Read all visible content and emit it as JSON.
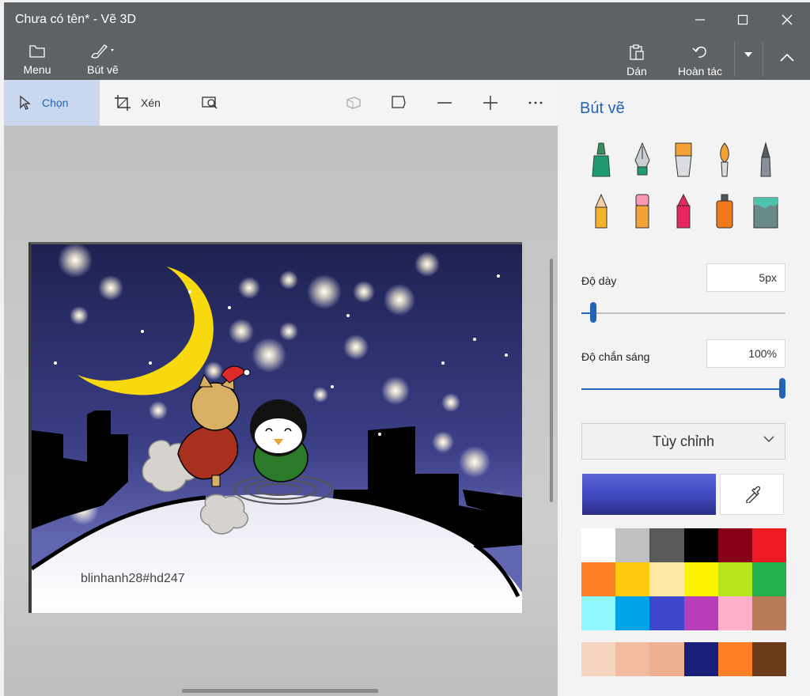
{
  "window": {
    "title": "Chưa có tên* - Vẽ 3D"
  },
  "ribbon": {
    "menu_label": "Menu",
    "brushes_label": "Bút vẽ",
    "paste_label": "Dán",
    "undo_label": "Hoàn tác"
  },
  "toolbar": {
    "select_label": "Chọn",
    "crop_label": "Xén"
  },
  "canvas": {
    "watermark_text": "blinhanh28#hd247"
  },
  "panel": {
    "title": "Bút vẽ",
    "brushes": [
      "marker",
      "calligraphy-pen",
      "oil-brush",
      "watercolor",
      "pixel-pen",
      "pencil",
      "eraser",
      "crayon",
      "spray-can",
      "fill-bucket"
    ],
    "thickness_label": "Độ dày",
    "thickness_value": "5px",
    "thickness_level": 0.05,
    "opacity_label": "Độ chắn sáng",
    "opacity_value": "100%",
    "opacity_level": 1.0,
    "finish_select": "Tùy chỉnh",
    "current_color": "#3e49c0",
    "palette": [
      "#ffffff",
      "#c0c0c0",
      "#595959",
      "#000000",
      "#880015",
      "#ed1c24",
      "#ff7f27",
      "#ffc90e",
      "#fde9a4",
      "#fff200",
      "#b5e61d",
      "#22b14c",
      "#8ff8ff",
      "#00a2e8",
      "#3f48cc",
      "#b83dba",
      "#ffaec9",
      "#b97a57"
    ],
    "custom_colors": [
      "#f5d4c0",
      "#f3bba0",
      "#efb091",
      "#1b1f7c",
      "#ff7f27",
      "#6b3b1a"
    ]
  }
}
